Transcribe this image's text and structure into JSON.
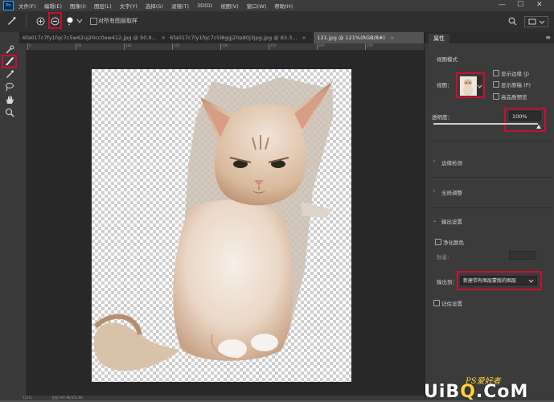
{
  "menu": {
    "logo": "Ps",
    "items": [
      "文件(F)",
      "编辑(E)",
      "图像(I)",
      "图层(L)",
      "文字(Y)",
      "选择(S)",
      "滤镜(T)",
      "3D(D)",
      "视图(V)",
      "窗口(W)",
      "帮助(H)"
    ]
  },
  "window_controls": {
    "minimize": "—",
    "maximize": "☐",
    "close": "✕"
  },
  "options_bar": {
    "sample_all_layers_label": "对所有图层取样",
    "sample_all_layers_checked": false
  },
  "tabs": [
    {
      "label": "6fa017c7fy1fqc7c5w62uj20cc0ew412.jpg @ 90.9...",
      "close": "×"
    },
    {
      "label": "6fa017c7ly1fqc7c5l8ggj20p80j3jpg.jpg @ 83.3...",
      "close": "×"
    },
    {
      "label": "121.jpg @ 121%(RGB/8#)",
      "close": "×"
    }
  ],
  "rulers": {
    "top_labels": [
      "0",
      "50",
      "100",
      "150",
      "200",
      "250",
      "300",
      "350"
    ]
  },
  "status_bar": {
    "zoom": "121%",
    "doc": "文档:197.9K/351.6K"
  },
  "properties_panel": {
    "tab": "属性",
    "view_mode_heading": "视图模式",
    "view_label": "视图：",
    "show_edge": "显示边缘 (J)",
    "show_original": "显示原稿 (P)",
    "high_quality_preview": "高品质预览",
    "opacity_label": "透明度：",
    "opacity_value": "100%",
    "opacity_fraction": 1.0,
    "edge_detection": "边缘检测",
    "global_refinements": "全局调整",
    "output_settings": "输出设置",
    "decontaminate_colors": "净化颜色",
    "amount_label": "数量：",
    "output_to_label": "输出到：",
    "output_to_value": "新建带有图层蒙版的图层",
    "remember_settings": "记住设置"
  },
  "watermark": {
    "line1": "PS爱好者",
    "line2_a": "UiB",
    "line2_b": "Q",
    "line2_c": ".CoM"
  },
  "colors": {
    "highlight": "#c8102e",
    "panel_bg": "#3b3b3b",
    "canvas_bg": "#282828"
  }
}
